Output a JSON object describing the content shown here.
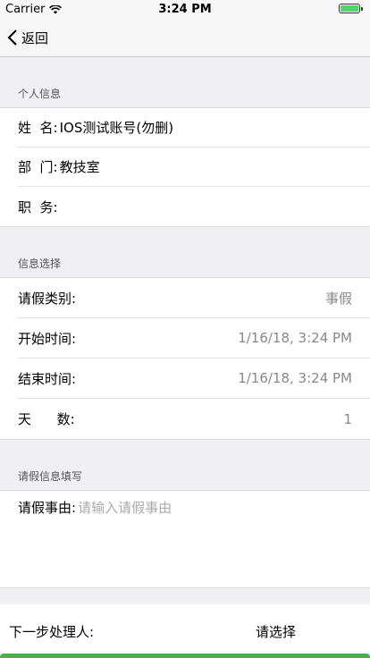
{
  "status_bar": {
    "carrier": "Carrier",
    "time": "3:24 PM"
  },
  "nav": {
    "back_label": "返回"
  },
  "personal_info": {
    "header": "个人信息",
    "rows": [
      {
        "label": "姓  名:",
        "value": "IOS测试账号(勿删)"
      },
      {
        "label": "部  门:",
        "value": "教技室"
      },
      {
        "label": "职  务:",
        "value": ""
      }
    ]
  },
  "info_select": {
    "header": "信息选择",
    "rows": [
      {
        "label": "请假类别:",
        "value": "事假"
      },
      {
        "label": "开始时间:",
        "value": "1/16/18, 3:24 PM"
      },
      {
        "label": "结束时间:",
        "value": "1/16/18, 3:24 PM"
      },
      {
        "label": "天      数:",
        "value": "1"
      }
    ]
  },
  "leave_info": {
    "header": "请假信息填写",
    "reason_label": "请假事由:",
    "reason_placeholder": "请输入请假事由"
  },
  "next_step": {
    "label": "下一步处理人:",
    "select": "请选择"
  }
}
